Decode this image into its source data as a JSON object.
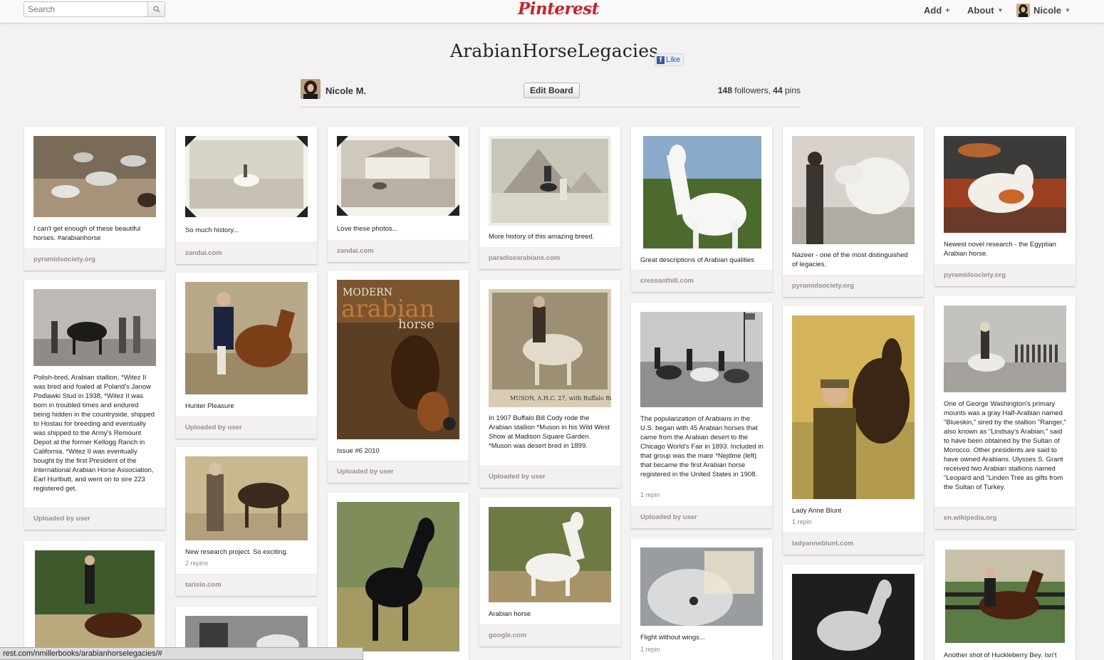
{
  "topbar": {
    "search_placeholder": "Search",
    "logo": "Pinterest",
    "nav": {
      "add": "Add",
      "add_symbol": "+",
      "about": "About",
      "user": "Nicole"
    }
  },
  "board": {
    "title": "ArabianHorseLegacies",
    "like_label": "Like",
    "owner": "Nicole M.",
    "edit_label": "Edit Board",
    "followers_count": "148",
    "followers_label": "followers,",
    "pins_count": "44",
    "pins_label": "pins"
  },
  "pins": [
    {
      "desc": "I can't get enough of these beautiful horses. #arabianhorse",
      "repins": "",
      "source": "pyramidsociety.org"
    },
    {
      "desc": "Polish-bred, Arabian stallion, *Witez II was bred and foaled at Poland's Janow Podlawki Stud in 1938, *Witez II was born in troubled times and endured being hidden in the countryside, shipped to Hostau for breeding and eventually was shipped to the Army's Remount Depot at the former Kellogg Ranch in California. *Witez II was eventually bought by the first President of the International Arabian Horse Association, Earl Hurlbutt, and went on to sire 223 registered get.",
      "repins": "",
      "source": "Uploaded by user"
    },
    {
      "desc": "",
      "repins": "",
      "source": ""
    },
    {
      "desc": "So much history...",
      "repins": "",
      "source": "zandai.com"
    },
    {
      "desc": "Hunter Pleasure",
      "repins": "",
      "source": "Uploaded by user"
    },
    {
      "desc": "New research project. So exciting.",
      "repins": "2 repins",
      "source": "tarisio.com"
    },
    {
      "desc": "",
      "repins": "",
      "source": ""
    },
    {
      "desc": "Love these photos...",
      "repins": "",
      "source": "zandai.com"
    },
    {
      "desc": "Issue #6 2010",
      "repins": "",
      "source": "Uploaded by user"
    },
    {
      "desc": "",
      "repins": "",
      "source": ""
    },
    {
      "desc": "More history of this amazing breed.",
      "repins": "",
      "source": "paradisearabians.com"
    },
    {
      "desc": "In 1907 Buffalo Bill Cody rode the Arabian stallion *Muson in his Wild West Show at Madison Square Garden. *Muson was desert bred in 1899.",
      "repins": "",
      "source": "Uploaded by user"
    },
    {
      "desc": "Arabian horse",
      "repins": "",
      "source": "google.com"
    },
    {
      "desc": "Great descriptions of Arabian qualities",
      "repins": "",
      "source": "cressanthill.com"
    },
    {
      "desc": "The popularization of Arabians in the U.S. began with 45 Arabian horses that came from the Arabian desert to the Chicago World's Fair in 1893. Included in that group was the mare *Nejdme (left) that became the first Arabian horse registered in the United States in 1908.",
      "repins": "1 repin",
      "source": "Uploaded by user"
    },
    {
      "desc": "Flight without wings...",
      "repins": "1 repin",
      "source": ""
    },
    {
      "desc": "Nazeer - one of the most distinguished of legacies.",
      "repins": "",
      "source": "pyramidsociety.org"
    },
    {
      "desc": "Lady Anne Blunt",
      "repins": "1 repin",
      "source": "ladyanneblunt.com"
    },
    {
      "desc": "",
      "repins": "",
      "source": ""
    },
    {
      "desc": "Newest novel research - the Egyptian Arabian horse.",
      "repins": "",
      "source": "pyramidsociety.org"
    },
    {
      "desc": "One of George Washington's primary mounts was a gray Half-Arabian named \"Blueskin,\" sired by the stallion \"Ranger,\" also known as \"Lindsay's Arabian,\" said to have been obtained by the Sultan of Morocco. Other presidents are said to have owned Arabians. Ulysses S. Grant received two Arabian stallions named \"Leopard and \"Linden Tree as gifts from the Sultan of Turkey.",
      "repins": "",
      "source": "en.wikipedia.org"
    },
    {
      "desc": "Another shot of Huckleberry Bey. Isn't",
      "repins": "",
      "source": ""
    }
  ],
  "statusbar": {
    "url": "rest.com/nmillerbooks/arabianhorselegacies/#"
  },
  "colors": {
    "brand": "#cb2027",
    "facebook": "#3b5998",
    "background": "#f3f1f1"
  }
}
